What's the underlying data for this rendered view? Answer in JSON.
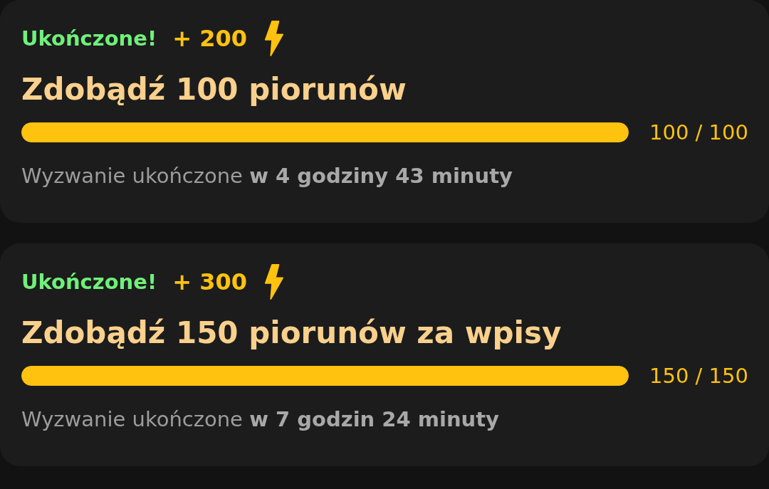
{
  "challenges": [
    {
      "status": "Ukończone!",
      "completed": true,
      "reward": "+ 200",
      "title": "Zdobądź 100 piorunów",
      "level": 1,
      "progress": "100 / 100",
      "footer": "Wyzwanie ukończone **w 4 godziny 43 minuty**"
    },
    {
      "status": "Ukończone!",
      "completed": true,
      "reward": "+ 300",
      "title": "Zdobądź 150 piorunów za wpisy",
      "level": 1,
      "progress": "150 / 150",
      "footer": "Wyzwanie ukończone **w 7 godzin 24 minuty**"
    }
  ]
}
